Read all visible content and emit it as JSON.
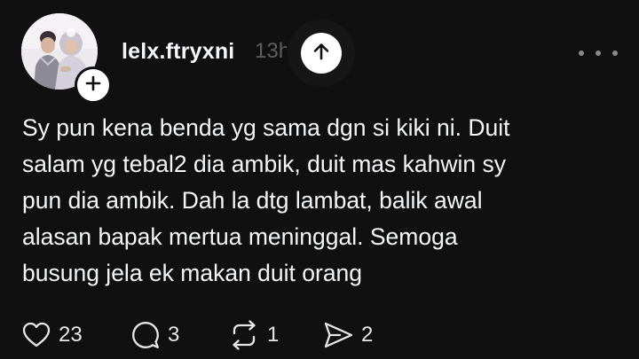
{
  "post": {
    "username": "lelx.ftryxni",
    "timestamp": "13h",
    "text": "Sy pun kena benda yg sama dgn si kiki ni. Duit\nsalam yg tebal2 dia ambik, duit mas kahwin sy\npun dia ambik. Dah la dtg lambat, balik awal\nalasan bapak mertua meninggal. Semoga\nbusung jela ek makan duit orang",
    "actions": {
      "likes": "23",
      "replies": "3",
      "reposts": "1",
      "shares": "2"
    }
  },
  "icons": {
    "avatar": "user-photo",
    "follow": "plus-icon",
    "scroll_top": "arrow-up-icon",
    "more": "more-horizontal-icon",
    "like": "heart-icon",
    "reply": "comment-icon",
    "repost": "repost-icon",
    "share": "send-icon"
  },
  "colors": {
    "background": "#101010",
    "text": "#f3f5f7",
    "muted": "#5f5f5f",
    "icon": "#e6e6e6"
  }
}
